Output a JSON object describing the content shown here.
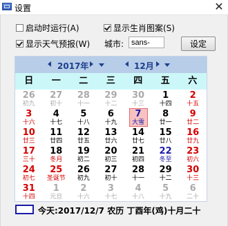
{
  "window": {
    "title": "设置",
    "close_glyph": "✕"
  },
  "options": {
    "autostart": {
      "label": "启动时运行(A)",
      "checked": false
    },
    "zodiac": {
      "label": "显示生肖图案(S)",
      "checked": true
    },
    "weather": {
      "label": "显示天气预报(W)",
      "checked": true
    }
  },
  "city": {
    "label": "城市:",
    "value": "sans-"
  },
  "set_button": "设定",
  "calendar": {
    "year_label": "2017年",
    "month_label": "12月",
    "weekdays": [
      "日",
      "一",
      "二",
      "三",
      "四",
      "五",
      "六"
    ],
    "days": [
      {
        "d": "26",
        "l": "初九",
        "cls": "c-other",
        "lc": ""
      },
      {
        "d": "27",
        "l": "初十",
        "cls": "c-other",
        "lc": ""
      },
      {
        "d": "28",
        "l": "十一",
        "cls": "c-other",
        "lc": ""
      },
      {
        "d": "29",
        "l": "十二",
        "cls": "c-other",
        "lc": ""
      },
      {
        "d": "30",
        "l": "十三",
        "cls": "c-other",
        "lc": ""
      },
      {
        "d": "1",
        "l": "十四",
        "cls": "c-normal",
        "lc": ""
      },
      {
        "d": "2",
        "l": "十五",
        "cls": "c-red",
        "lc": "lun-red"
      },
      {
        "d": "3",
        "l": "十六",
        "cls": "c-red",
        "lc": "lun-red"
      },
      {
        "d": "4",
        "l": "十七",
        "cls": "c-normal",
        "lc": ""
      },
      {
        "d": "5",
        "l": "十八",
        "cls": "c-normal",
        "lc": ""
      },
      {
        "d": "6",
        "l": "十九",
        "cls": "c-normal",
        "lc": ""
      },
      {
        "d": "7",
        "l": "大雪",
        "cls": "c-blue",
        "lc": "c-blue",
        "today": true
      },
      {
        "d": "8",
        "l": "廿一",
        "cls": "c-normal",
        "lc": ""
      },
      {
        "d": "9",
        "l": "廿二",
        "cls": "c-red",
        "lc": "lun-red"
      },
      {
        "d": "10",
        "l": "廿三",
        "cls": "c-red",
        "lc": "lun-red"
      },
      {
        "d": "11",
        "l": "廿四",
        "cls": "c-normal",
        "lc": ""
      },
      {
        "d": "12",
        "l": "廿五",
        "cls": "c-normal",
        "lc": ""
      },
      {
        "d": "13",
        "l": "廿六",
        "cls": "c-normal",
        "lc": ""
      },
      {
        "d": "14",
        "l": "廿七",
        "cls": "c-normal",
        "lc": ""
      },
      {
        "d": "15",
        "l": "廿八",
        "cls": "c-normal",
        "lc": ""
      },
      {
        "d": "16",
        "l": "廿九",
        "cls": "c-red",
        "lc": "lun-red"
      },
      {
        "d": "17",
        "l": "三十",
        "cls": "c-red",
        "lc": "lun-red"
      },
      {
        "d": "18",
        "l": "冬月",
        "cls": "c-normal",
        "lc": "lun-red"
      },
      {
        "d": "19",
        "l": "初二",
        "cls": "c-normal",
        "lc": ""
      },
      {
        "d": "20",
        "l": "初三",
        "cls": "c-normal",
        "lc": ""
      },
      {
        "d": "21",
        "l": "初四",
        "cls": "c-normal",
        "lc": ""
      },
      {
        "d": "22",
        "l": "冬至",
        "cls": "c-blue",
        "lc": "c-blue"
      },
      {
        "d": "23",
        "l": "初六",
        "cls": "c-red",
        "lc": "lun-red"
      },
      {
        "d": "24",
        "l": "初七",
        "cls": "c-red",
        "lc": "lun-red"
      },
      {
        "d": "25",
        "l": "圣诞节",
        "cls": "c-red",
        "lc": ""
      },
      {
        "d": "26",
        "l": "初九",
        "cls": "c-normal",
        "lc": ""
      },
      {
        "d": "27",
        "l": "初十",
        "cls": "c-normal",
        "lc": ""
      },
      {
        "d": "28",
        "l": "十一",
        "cls": "c-normal",
        "lc": ""
      },
      {
        "d": "29",
        "l": "十二",
        "cls": "c-normal",
        "lc": ""
      },
      {
        "d": "30",
        "l": "十三",
        "cls": "c-red",
        "lc": "lun-red"
      },
      {
        "d": "31",
        "l": "十四",
        "cls": "c-red",
        "lc": "lun-red"
      },
      {
        "d": "1",
        "l": "元旦",
        "cls": "c-other",
        "lc": ""
      },
      {
        "d": "2",
        "l": "十六",
        "cls": "c-other",
        "lc": ""
      },
      {
        "d": "3",
        "l": "十七",
        "cls": "c-other",
        "lc": ""
      },
      {
        "d": "4",
        "l": "十八",
        "cls": "c-other",
        "lc": ""
      },
      {
        "d": "5",
        "l": "十九",
        "cls": "c-other",
        "lc": ""
      },
      {
        "d": "6",
        "l": "二十",
        "cls": "c-other",
        "lc": ""
      }
    ]
  },
  "today_text": "今天:2017/12/7 农历 丁酉年(鸡)十月二十",
  "colors": {
    "header": "#b7cde8",
    "weekrow": "#ccf7f8",
    "today": "#f7c2c2",
    "red": "#d40000",
    "blue": "#1a1aa8"
  }
}
